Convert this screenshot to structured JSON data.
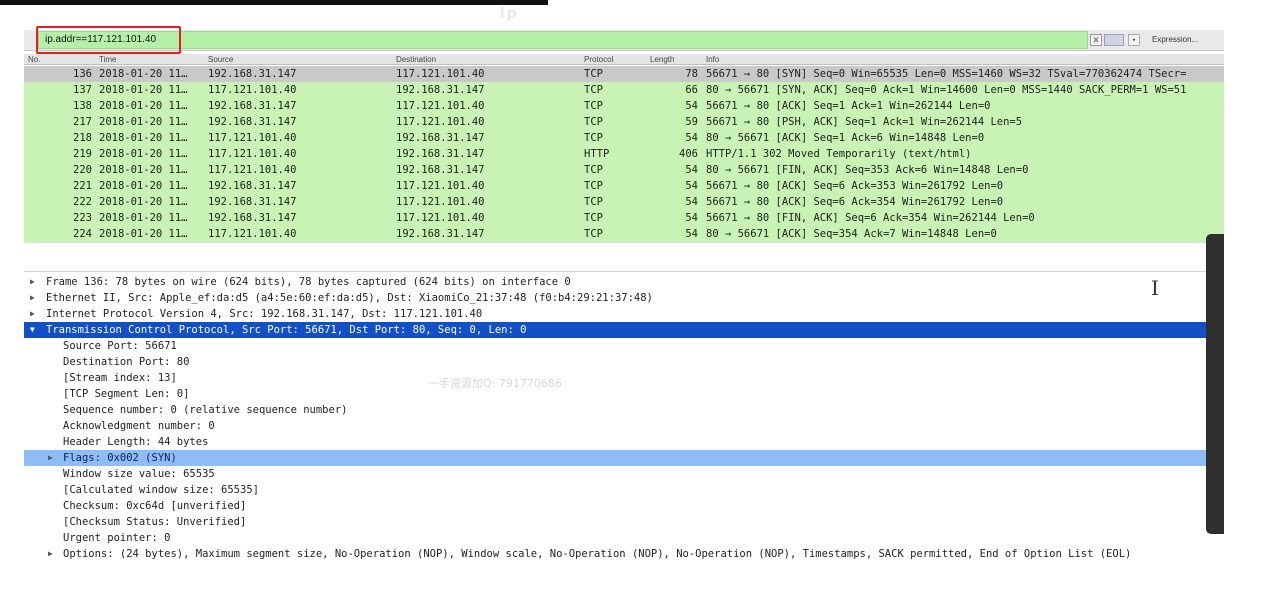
{
  "overlay": {
    "title_fragment": "ip"
  },
  "filter": {
    "value": "ip.addr==117.121.101.40",
    "clear_icon": "✕",
    "dropdown_icon": "▾",
    "expression_label": "Expression..."
  },
  "columns": {
    "no": "No.",
    "time": "Time",
    "source": "Source",
    "destination": "Destination",
    "protocol": "Protocol",
    "length": "Length",
    "info": "Info"
  },
  "packets": [
    {
      "no": "136",
      "time": "2018-01-20 11…",
      "src": "192.168.31.147",
      "dst": "117.121.101.40",
      "proto": "TCP",
      "len": "78",
      "info": "56671 → 80 [SYN] Seq=0 Win=65535 Len=0 MSS=1460 WS=32 TSval=770362474 TSecr="
    },
    {
      "no": "137",
      "time": "2018-01-20 11…",
      "src": "117.121.101.40",
      "dst": "192.168.31.147",
      "proto": "TCP",
      "len": "66",
      "info": "80 → 56671 [SYN, ACK] Seq=0 Ack=1 Win=14600 Len=0 MSS=1440 SACK_PERM=1 WS=51"
    },
    {
      "no": "138",
      "time": "2018-01-20 11…",
      "src": "192.168.31.147",
      "dst": "117.121.101.40",
      "proto": "TCP",
      "len": "54",
      "info": "56671 → 80 [ACK] Seq=1 Ack=1 Win=262144 Len=0"
    },
    {
      "no": "217",
      "time": "2018-01-20 11…",
      "src": "192.168.31.147",
      "dst": "117.121.101.40",
      "proto": "TCP",
      "len": "59",
      "info": "56671 → 80 [PSH, ACK] Seq=1 Ack=1 Win=262144 Len=5"
    },
    {
      "no": "218",
      "time": "2018-01-20 11…",
      "src": "117.121.101.40",
      "dst": "192.168.31.147",
      "proto": "TCP",
      "len": "54",
      "info": "80 → 56671 [ACK] Seq=1 Ack=6 Win=14848 Len=0"
    },
    {
      "no": "219",
      "time": "2018-01-20 11…",
      "src": "117.121.101.40",
      "dst": "192.168.31.147",
      "proto": "HTTP",
      "len": "406",
      "info": "HTTP/1.1 302 Moved Temporarily  (text/html)"
    },
    {
      "no": "220",
      "time": "2018-01-20 11…",
      "src": "117.121.101.40",
      "dst": "192.168.31.147",
      "proto": "TCP",
      "len": "54",
      "info": "80 → 56671 [FIN, ACK] Seq=353 Ack=6 Win=14848 Len=0"
    },
    {
      "no": "221",
      "time": "2018-01-20 11…",
      "src": "192.168.31.147",
      "dst": "117.121.101.40",
      "proto": "TCP",
      "len": "54",
      "info": "56671 → 80 [ACK] Seq=6 Ack=353 Win=261792 Len=0"
    },
    {
      "no": "222",
      "time": "2018-01-20 11…",
      "src": "192.168.31.147",
      "dst": "117.121.101.40",
      "proto": "TCP",
      "len": "54",
      "info": "56671 → 80 [ACK] Seq=6 Ack=354 Win=261792 Len=0"
    },
    {
      "no": "223",
      "time": "2018-01-20 11…",
      "src": "192.168.31.147",
      "dst": "117.121.101.40",
      "proto": "TCP",
      "len": "54",
      "info": "56671 → 80 [FIN, ACK] Seq=6 Ack=354 Win=262144 Len=0"
    },
    {
      "no": "224",
      "time": "2018-01-20 11…",
      "src": "117.121.101.40",
      "dst": "192.168.31.147",
      "proto": "TCP",
      "len": "54",
      "info": "80 → 56671 [ACK] Seq=354 Ack=7 Win=14848 Len=0"
    }
  ],
  "details": {
    "frame": "Frame 136: 78 bytes on wire (624 bits), 78 bytes captured (624 bits) on interface 0",
    "ethernet": "Ethernet II, Src: Apple_ef:da:d5 (a4:5e:60:ef:da:d5), Dst: XiaomiCo_21:37:48 (f0:b4:29:21:37:48)",
    "ip": "Internet Protocol Version 4, Src: 192.168.31.147, Dst: 117.121.101.40",
    "tcp": "Transmission Control Protocol, Src Port: 56671, Dst Port: 80, Seq: 0, Len: 0",
    "tcp_fields": {
      "src_port": "Source Port: 56671",
      "dst_port": "Destination Port: 80",
      "stream_index": "[Stream index: 13]",
      "segment_len": "[TCP Segment Len: 0]",
      "seq": "Sequence number: 0    (relative sequence number)",
      "ack": "Acknowledgment number: 0",
      "header_len": "Header Length: 44 bytes",
      "flags": "Flags: 0x002 (SYN)",
      "window": "Window size value: 65535",
      "calc_window": "[Calculated window size: 65535]",
      "checksum": "Checksum: 0xc64d [unverified]",
      "checksum_status": "[Checksum Status: Unverified]",
      "urgent": "Urgent pointer: 0",
      "options": "Options: (24 bytes), Maximum segment size, No-Operation (NOP), Window scale, No-Operation (NOP), No-Operation (NOP), Timestamps, SACK permitted, End of Option List (EOL)"
    },
    "collapsed_icon": "▶",
    "expanded_icon": "▼"
  },
  "watermark": "一手资源加Q: 791770686",
  "cursor_icon": "I",
  "colors": {
    "list_bg": "#c8f3b4",
    "selected_tree": "#1350c6",
    "flags_row": "#8fbcf4",
    "filter_bg": "#b6f0a8",
    "highlight_box": "#e0211d"
  }
}
